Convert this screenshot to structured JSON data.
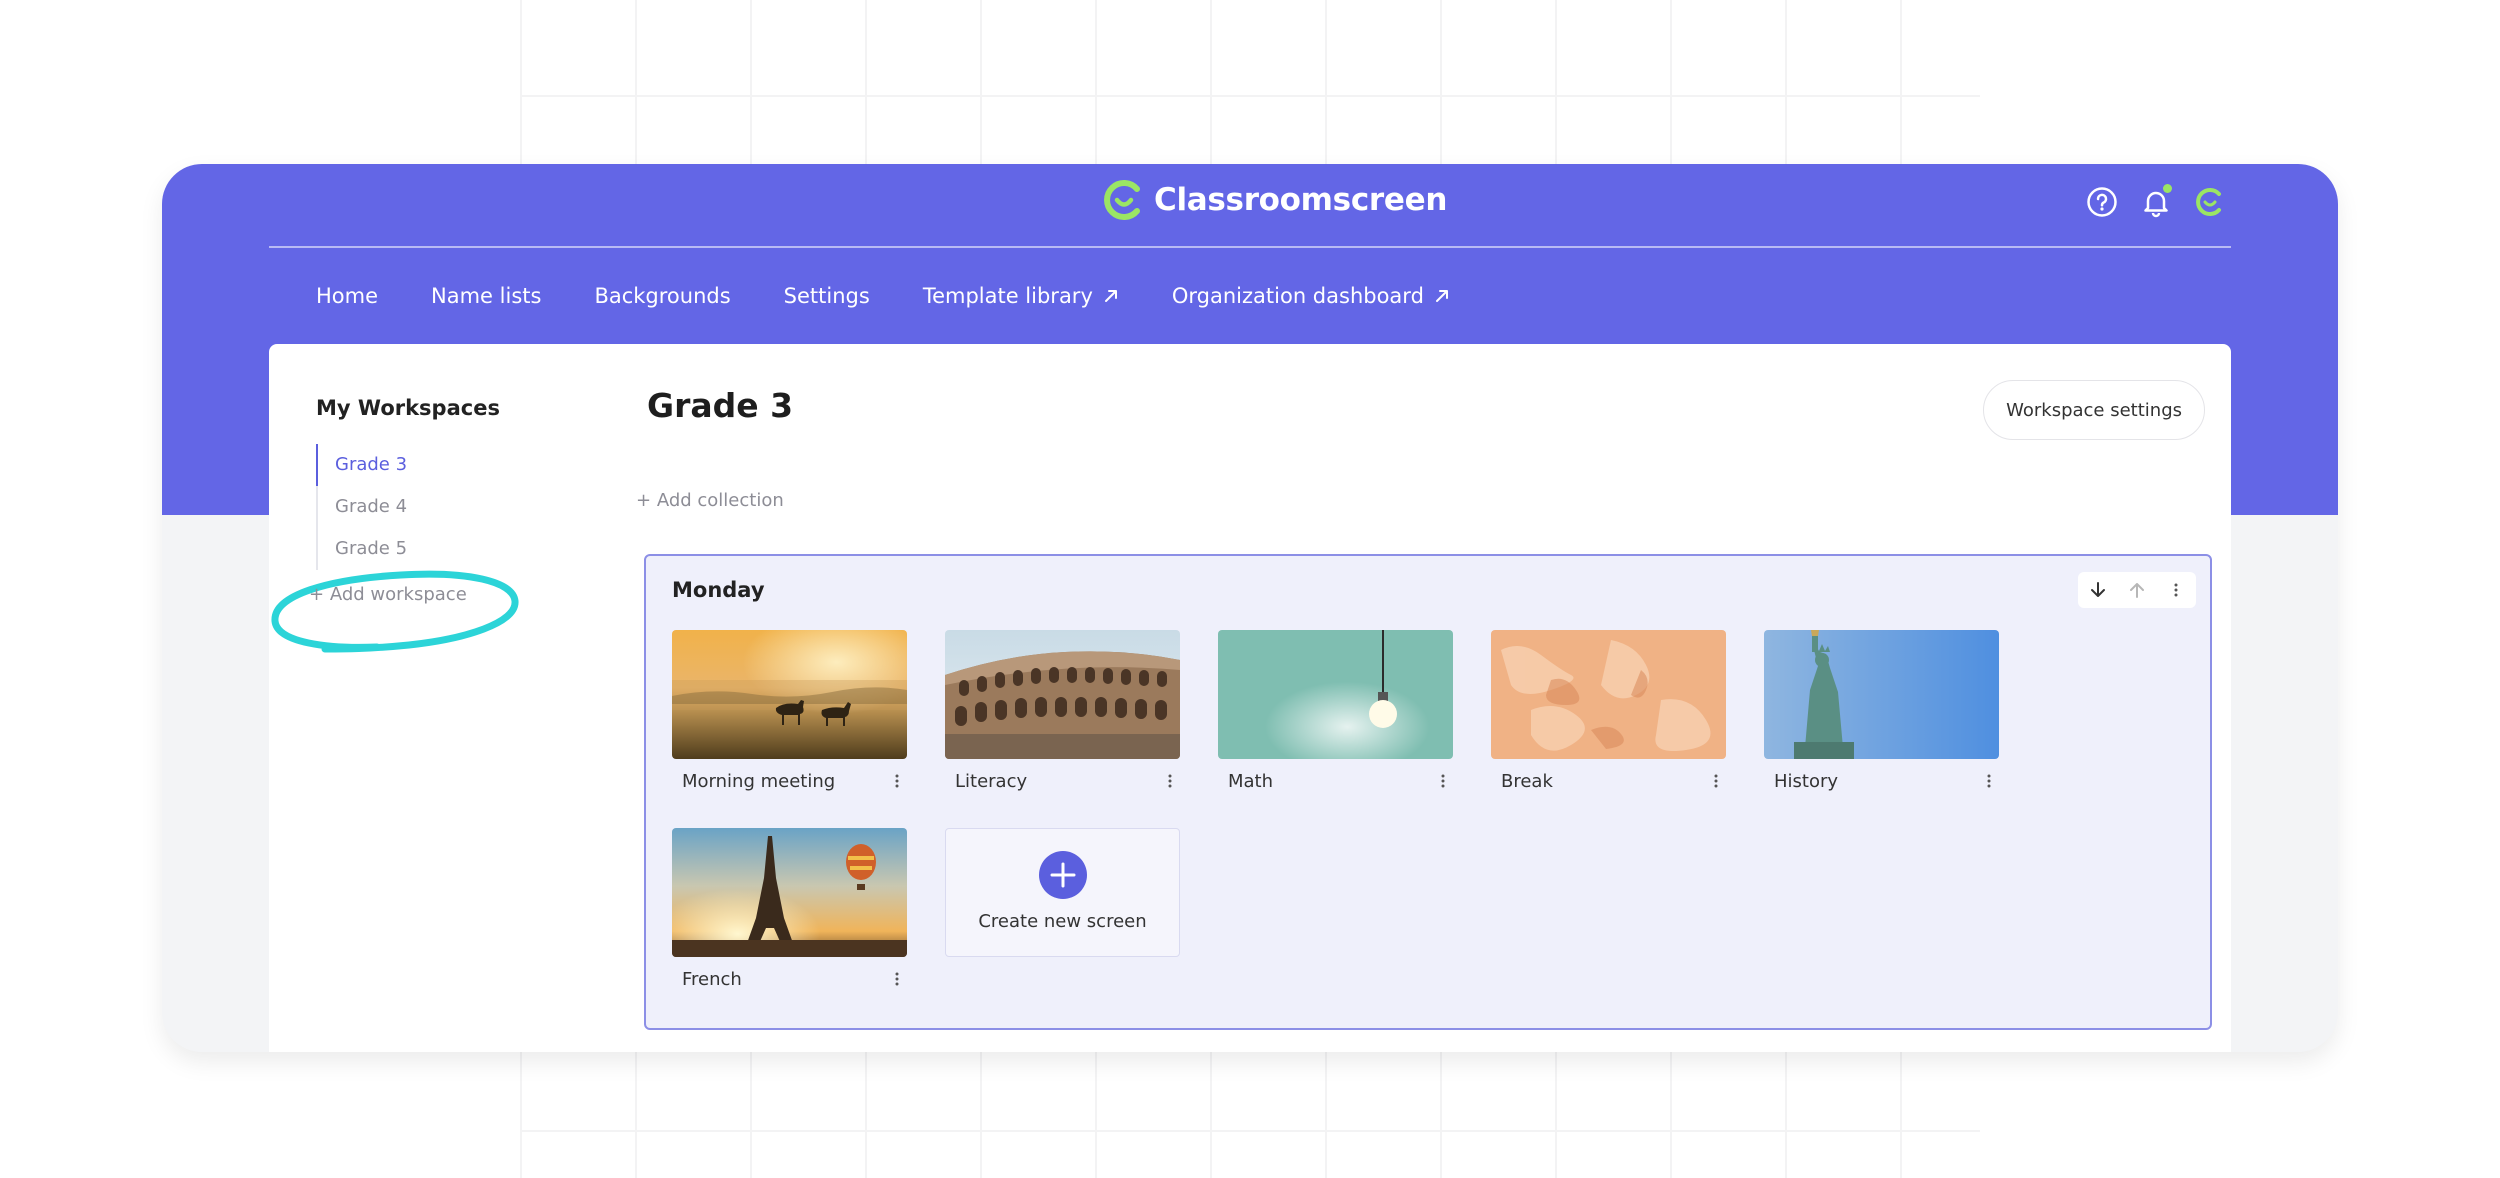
{
  "app": {
    "name": "Classroomscreen"
  },
  "colors": {
    "brand": "#6366e6",
    "accent_green": "#9be564",
    "highlight_circle": "#2cd4d8",
    "active": "#5b5fde"
  },
  "topbar": {
    "icons": [
      "help-icon",
      "bell-icon",
      "profile-logo-icon"
    ]
  },
  "nav": {
    "home": "Home",
    "name_lists": "Name lists",
    "backgrounds": "Backgrounds",
    "settings": "Settings",
    "template_library": "Template library",
    "org_dashboard": "Organization dashboard"
  },
  "sidebar": {
    "title": "My Workspaces",
    "items": [
      {
        "label": "Grade 3",
        "active": true
      },
      {
        "label": "Grade 4"
      },
      {
        "label": "Grade 5"
      }
    ],
    "add_workspace": "Add workspace"
  },
  "main": {
    "title": "Grade 3",
    "workspace_settings": "Workspace settings",
    "add_collection": "Add collection"
  },
  "collection": {
    "title": "Monday",
    "tools": [
      "arrow-down-icon",
      "arrow-up-icon",
      "more-icon"
    ],
    "screens": [
      {
        "label": "Morning meeting",
        "image": "horses-in-foggy-field"
      },
      {
        "label": "Literacy",
        "image": "colosseum"
      },
      {
        "label": "Math",
        "image": "light-bulb"
      },
      {
        "label": "Break",
        "image": "orange-texture"
      },
      {
        "label": "History",
        "image": "statue-of-liberty"
      },
      {
        "label": "French",
        "image": "eiffel-tower-balloon"
      }
    ],
    "create_label": "Create new screen"
  }
}
